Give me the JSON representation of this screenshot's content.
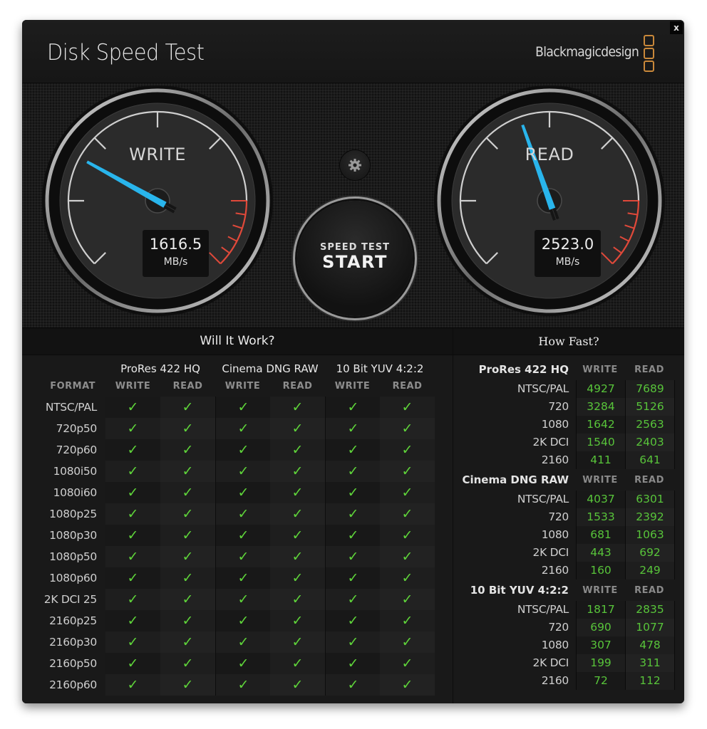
{
  "window": {
    "title": "Disk Speed Test",
    "brand": "Blackmagicdesign",
    "close_label": "x",
    "brand_color": "#c9883a"
  },
  "gauges": {
    "scale_max_mbps": 5900,
    "write": {
      "label": "WRITE",
      "value": "1616.5",
      "value_num": 1616.5,
      "unit": "MB/s"
    },
    "read": {
      "label": "READ",
      "value": "2523.0",
      "value_num": 2523.0,
      "unit": "MB/s"
    },
    "needle_color": "#29b5ec",
    "redline_color": "#e0493a"
  },
  "controls": {
    "settings_icon": "gear-icon",
    "start_sub": "SPEED TEST",
    "start_main": "START"
  },
  "will_it_work": {
    "title": "Will It Work?",
    "format_header": "FORMAT",
    "codecs": [
      "ProRes 422 HQ",
      "Cinema DNG RAW",
      "10 Bit YUV 4:2:2"
    ],
    "subcols": [
      "WRITE",
      "READ"
    ],
    "check_glyph": "✓",
    "check_color": "#5fd53a",
    "rows": [
      {
        "format": "NTSC/PAL",
        "checks": [
          true,
          true,
          true,
          true,
          true,
          true
        ]
      },
      {
        "format": "720p50",
        "checks": [
          true,
          true,
          true,
          true,
          true,
          true
        ]
      },
      {
        "format": "720p60",
        "checks": [
          true,
          true,
          true,
          true,
          true,
          true
        ]
      },
      {
        "format": "1080i50",
        "checks": [
          true,
          true,
          true,
          true,
          true,
          true
        ]
      },
      {
        "format": "1080i60",
        "checks": [
          true,
          true,
          true,
          true,
          true,
          true
        ]
      },
      {
        "format": "1080p25",
        "checks": [
          true,
          true,
          true,
          true,
          true,
          true
        ]
      },
      {
        "format": "1080p30",
        "checks": [
          true,
          true,
          true,
          true,
          true,
          true
        ]
      },
      {
        "format": "1080p50",
        "checks": [
          true,
          true,
          true,
          true,
          true,
          true
        ]
      },
      {
        "format": "1080p60",
        "checks": [
          true,
          true,
          true,
          true,
          true,
          true
        ]
      },
      {
        "format": "2K DCI 25",
        "checks": [
          true,
          true,
          true,
          true,
          true,
          true
        ]
      },
      {
        "format": "2160p25",
        "checks": [
          true,
          true,
          true,
          true,
          true,
          true
        ]
      },
      {
        "format": "2160p30",
        "checks": [
          true,
          true,
          true,
          true,
          true,
          true
        ]
      },
      {
        "format": "2160p50",
        "checks": [
          true,
          true,
          true,
          true,
          true,
          true
        ]
      },
      {
        "format": "2160p60",
        "checks": [
          true,
          true,
          true,
          true,
          true,
          true
        ]
      }
    ]
  },
  "how_fast": {
    "title": "How Fast?",
    "write_label": "WRITE",
    "read_label": "READ",
    "sections": [
      {
        "codec": "ProRes 422 HQ",
        "rows": [
          {
            "format": "NTSC/PAL",
            "write": "4927",
            "read": "7689"
          },
          {
            "format": "720",
            "write": "3284",
            "read": "5126"
          },
          {
            "format": "1080",
            "write": "1642",
            "read": "2563"
          },
          {
            "format": "2K DCI",
            "write": "1540",
            "read": "2403"
          },
          {
            "format": "2160",
            "write": "411",
            "read": "641"
          }
        ]
      },
      {
        "codec": "Cinema DNG RAW",
        "rows": [
          {
            "format": "NTSC/PAL",
            "write": "4037",
            "read": "6301"
          },
          {
            "format": "720",
            "write": "1533",
            "read": "2392"
          },
          {
            "format": "1080",
            "write": "681",
            "read": "1063"
          },
          {
            "format": "2K DCI",
            "write": "443",
            "read": "692"
          },
          {
            "format": "2160",
            "write": "160",
            "read": "249"
          }
        ]
      },
      {
        "codec": "10 Bit YUV 4:2:2",
        "rows": [
          {
            "format": "NTSC/PAL",
            "write": "1817",
            "read": "2835"
          },
          {
            "format": "720",
            "write": "690",
            "read": "1077"
          },
          {
            "format": "1080",
            "write": "307",
            "read": "478"
          },
          {
            "format": "2K DCI",
            "write": "199",
            "read": "311"
          },
          {
            "format": "2160",
            "write": "72",
            "read": "112"
          }
        ]
      }
    ]
  }
}
